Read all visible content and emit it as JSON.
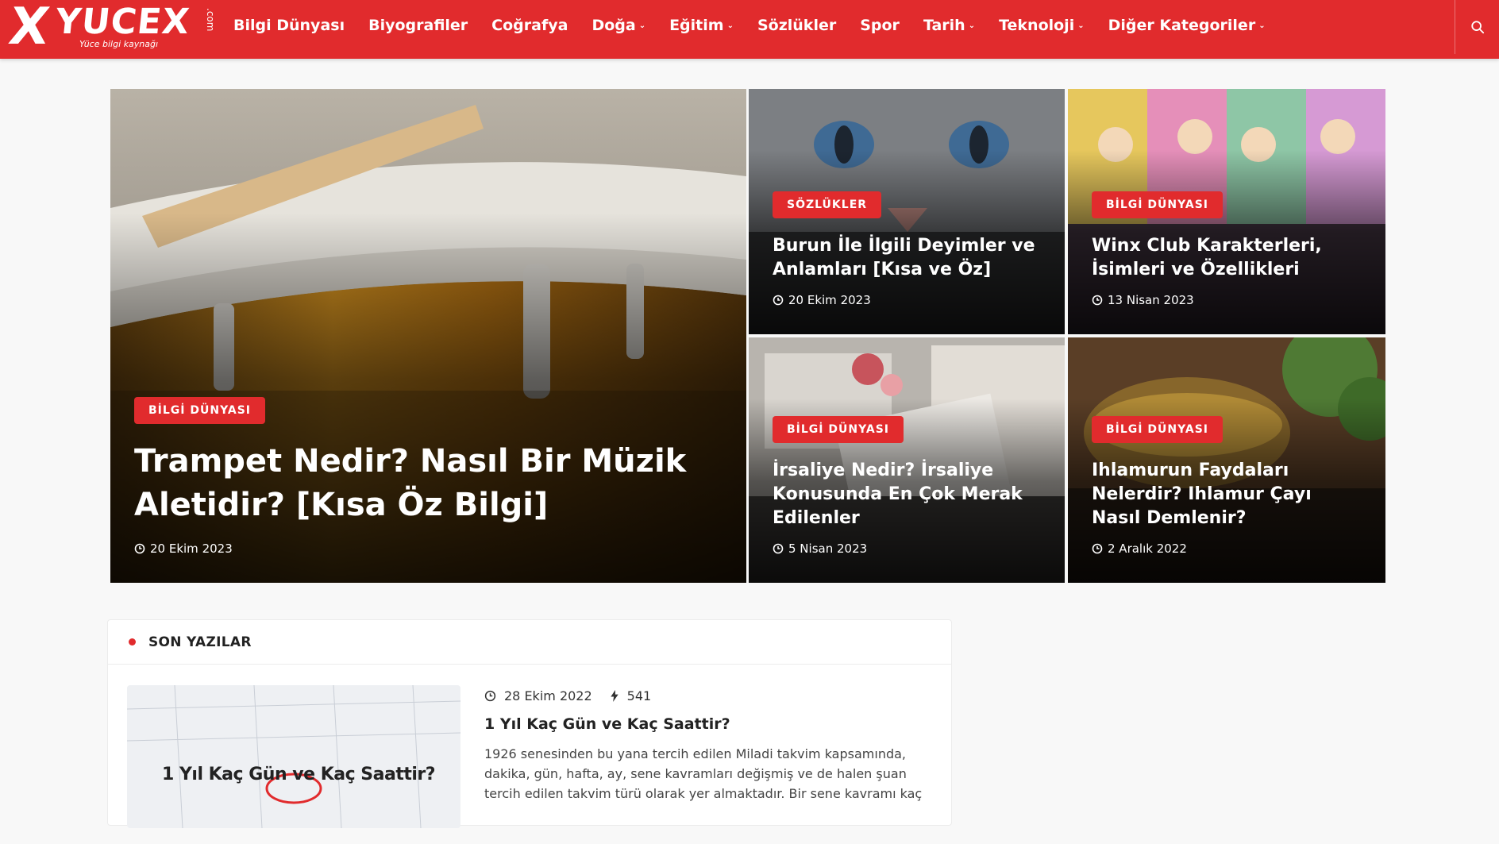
{
  "header": {
    "logo_text": "YUCEX",
    "logo_suffix": ".com",
    "logo_tagline": "Yüce bilgi kaynağı",
    "accent_color": "#e12b2d",
    "nav": [
      {
        "label": "Bilgi Dünyası",
        "has_dropdown": false
      },
      {
        "label": "Biyografiler",
        "has_dropdown": false
      },
      {
        "label": "Coğrafya",
        "has_dropdown": false
      },
      {
        "label": "Doğa",
        "has_dropdown": true
      },
      {
        "label": "Eğitim",
        "has_dropdown": true
      },
      {
        "label": "Sözlükler",
        "has_dropdown": false
      },
      {
        "label": "Spor",
        "has_dropdown": false
      },
      {
        "label": "Tarih",
        "has_dropdown": true
      },
      {
        "label": "Teknoloji",
        "has_dropdown": true
      },
      {
        "label": "Diğer Kategoriler",
        "has_dropdown": true
      }
    ],
    "search_icon": "search-icon"
  },
  "featured": [
    {
      "category": "BİLGİ DÜNYASI",
      "title": "Trampet Nedir? Nasıl Bir Müzik Aletidir? [Kısa Öz Bilgi]",
      "date": "20 Ekim 2023"
    },
    {
      "category": "SÖZLÜKLER",
      "title": "Burun İle İlgili Deyimler ve Anlamları [Kısa ve Öz]",
      "date": "20 Ekim 2023"
    },
    {
      "category": "BİLGİ DÜNYASI",
      "title": "Winx Club Karakterleri, İsimleri ve Özellikleri",
      "date": "13 Nisan 2023"
    },
    {
      "category": "BİLGİ DÜNYASI",
      "title": "İrsaliye Nedir? İrsaliye Konusunda En Çok Merak Edilenler",
      "date": "5 Nisan 2023"
    },
    {
      "category": "BİLGİ DÜNYASI",
      "title": "Ihlamurun Faydaları Nelerdir? Ihlamur Çayı Nasıl Demlenir?",
      "date": "2 Aralık 2022"
    }
  ],
  "latest": {
    "section_title": "SON YAZILAR",
    "posts": [
      {
        "thumb_caption": "1 Yıl Kaç Gün ve Kaç Saattir?",
        "date": "28 Ekim 2022",
        "views": "541",
        "title": "1 Yıl Kaç Gün ve Kaç Saattir?",
        "excerpt": "1926 senesinden bu yana tercih edilen Miladi takvim kapsamında, dakika, gün, hafta, ay, sene kavramları değişmiş ve de halen şuan tercih edilen takvim türü olarak yer almaktadır. Bir sene kavramı kaç"
      }
    ]
  }
}
